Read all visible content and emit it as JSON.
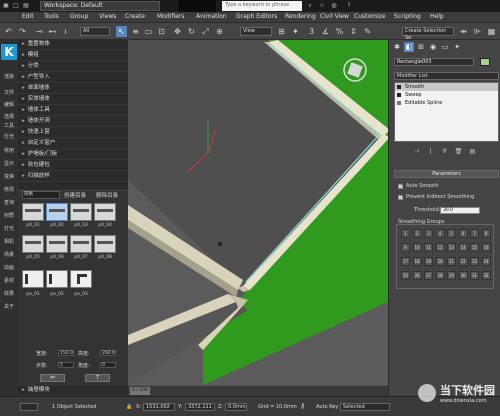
{
  "titlebar": {
    "workspace": "Workspace: Default",
    "search_placeholder": "Type a keyword or phrase"
  },
  "menu": [
    "Edit",
    "Tools",
    "Group",
    "Views",
    "Create",
    "Modifiers",
    "Animation",
    "Graph Editors",
    "Rendering",
    "Civil View",
    "Customize",
    "Scripting",
    "Help"
  ],
  "toolbar": {
    "filter_value": "All",
    "view_value": "View",
    "selection_set_value": "Create Selection Se"
  },
  "left_column": {
    "logo_letter": "K",
    "items": [
      "渲染",
      "文件",
      "编辑",
      "选择",
      "工具",
      "灯光",
      "常用",
      "显示",
      "变换",
      "修改",
      "查询",
      "材质",
      "灯光",
      "相机",
      "场景",
      "动画",
      "素材",
      "效果",
      "关于"
    ]
  },
  "categories": [
    "重置物体",
    "模组",
    "分类",
    "户型导入",
    "单面墙体",
    "实体墙体",
    "墙体工具",
    "墙体开洞",
    "快速上窗",
    "自定义窗户",
    "护墙板/门板",
    "软包硬包",
    "扫描放样"
  ],
  "library": {
    "style_select": "风格",
    "tab_create": "创建目录",
    "tab_delete": "删除目录",
    "thumbnails": [
      "p0_01",
      "p0_02",
      "p0_03",
      "p0_04",
      "p0_05",
      "p0_06",
      "p0_07",
      "p0_08",
      "pa_01",
      "pa_02",
      "pa_03"
    ],
    "params": [
      {
        "label": "宽度:",
        "value": "150.0"
      },
      {
        "label": "高度:",
        "value": "260.0"
      },
      {
        "label": "步数:",
        "value": "5"
      },
      {
        "label": "角度:",
        "value": "0"
      }
    ],
    "footer": "抽屉模块"
  },
  "command_panel": {
    "object_name": "Rectangle003",
    "object_color": "#a8d08d",
    "modifier_list": "Modifier List",
    "stack": [
      "Smooth",
      "Sweep",
      "Editable Spline"
    ],
    "parameters_title": "Parameters",
    "auto_smooth": "Auto Smooth",
    "prevent_indirect": "Prevent Indirect Smoothing",
    "threshold_label": "Threshold:",
    "threshold_value": "30.0",
    "smoothing_groups_label": "Smoothing Groups",
    "smoothing_groups": [
      "1",
      "2",
      "3",
      "4",
      "5",
      "6",
      "7",
      "8",
      "9",
      "10",
      "11",
      "12",
      "13",
      "14",
      "15",
      "16",
      "17",
      "18",
      "19",
      "20",
      "21",
      "22",
      "23",
      "24",
      "25",
      "26",
      "27",
      "28",
      "29",
      "30",
      "31",
      "32"
    ]
  },
  "timeslider": {
    "position": "0 / 100"
  },
  "statusbar": {
    "selection": "1 Object Selected",
    "x_label": "X:",
    "x_value": "1531.002",
    "y_label": "Y:",
    "y_value": "3372.111",
    "z_label": "Z:",
    "z_value": "0.0mm",
    "grid": "Grid = 10.0mm",
    "autokey": "Auto Key",
    "selected": "Selected"
  },
  "watermark": {
    "title": "当下软件园",
    "url": "www.downxia.com"
  },
  "colors": {
    "accent": "#5a86bf",
    "logo": "#1c98d6",
    "grass": "#2f9a1e",
    "wall": "#e7e3cc",
    "viewport": "#5b5b5b"
  }
}
